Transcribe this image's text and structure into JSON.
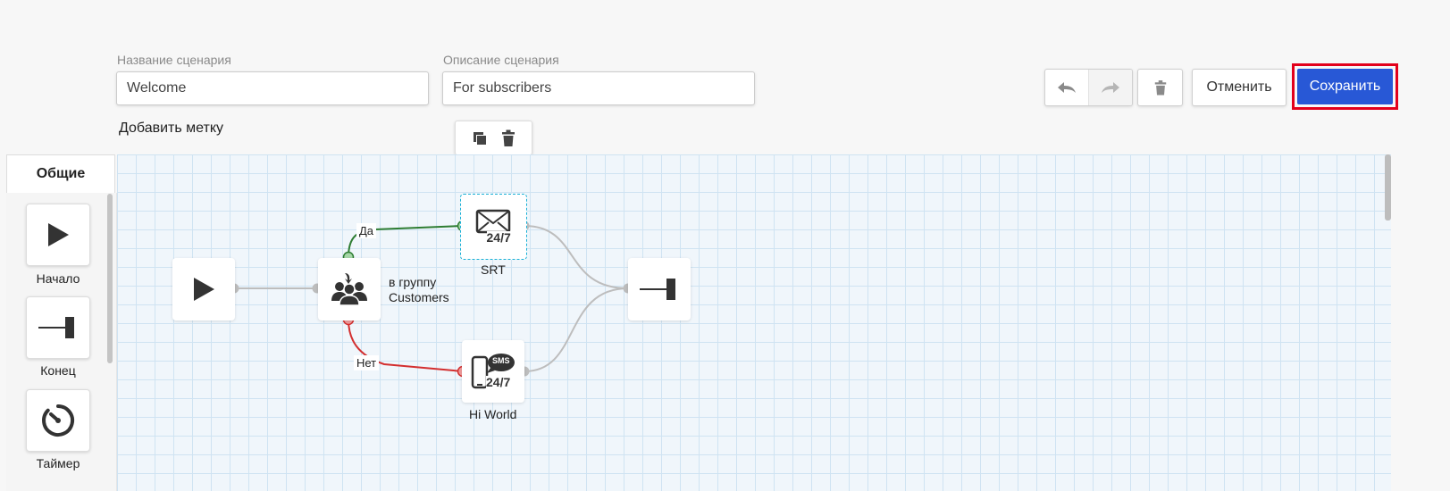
{
  "form": {
    "name_label": "Название сценария",
    "name_value": "Welcome",
    "desc_label": "Описание сценария",
    "desc_value": "For subscribers",
    "add_tag": "Добавить метку"
  },
  "toolbar": {
    "cancel_label": "Отменить",
    "save_label": "Сохранить",
    "icons": [
      "undo-icon",
      "redo-icon",
      "trash-icon",
      "copy-icon"
    ]
  },
  "sidebar": {
    "tab_label": "Общие",
    "items": [
      {
        "label": "Начало",
        "icon": "play-icon"
      },
      {
        "label": "Конец",
        "icon": "end-icon"
      },
      {
        "label": "Таймер",
        "icon": "timer-icon"
      }
    ]
  },
  "flow": {
    "group_node_label": "в группу\nCustomers",
    "email_node_label": "SRT",
    "sms_node_label": "Hi World",
    "yes_label": "Да",
    "no_label": "Нет",
    "badge_text": "24/7",
    "sms_badge": "SMS",
    "colors": {
      "yes": "#2e7d32",
      "no": "#d32f2f",
      "connector": "#bdbdbd",
      "accent": "#2858d6",
      "highlight": "#e3001b"
    }
  }
}
